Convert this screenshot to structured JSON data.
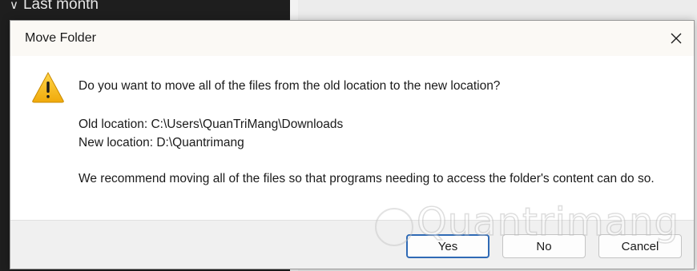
{
  "background": {
    "sidebar_group_label": "Last month"
  },
  "dialog": {
    "title": "Move Folder",
    "icon": "warning-icon",
    "close_icon": "close-icon",
    "question": "Do you want to move all of the files from the old location to the new location?",
    "old_location": "Old location: C:\\Users\\QuanTriMang\\Downloads",
    "new_location": "New location: D:\\Quantrimang",
    "recommendation": "We recommend moving all of the files so that programs needing to access the folder's content can do so.",
    "buttons": {
      "yes": "Yes",
      "no": "No",
      "cancel": "Cancel"
    },
    "colors": {
      "warning_fill": "#f4c430",
      "default_button_border": "#2f6ab5"
    }
  },
  "watermark": {
    "text": "Quantrimang"
  }
}
